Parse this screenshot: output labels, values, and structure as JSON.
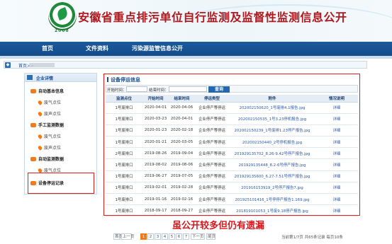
{
  "site": {
    "title": "安徽省重点排污单位自行监测及监督性监测信息公开",
    "logo_year": "2008",
    "accent": "#b0181d"
  },
  "nav": {
    "items": [
      "首页",
      "文件资料",
      "污染源监管信息公开"
    ]
  },
  "breadcrumb": {
    "label": "首页>>"
  },
  "sidebar": {
    "header": "企业详情",
    "sections": [
      {
        "label": "自动基本信息",
        "items": [
          "废气点位",
          "废声点位"
        ]
      },
      {
        "label": "手工监测数据",
        "items": [
          "废气点位",
          "废声点位"
        ]
      },
      {
        "label": "自动监测数据",
        "items": [
          "废气点位"
        ]
      },
      {
        "label": "设备停运记录",
        "items": []
      }
    ]
  },
  "panel": {
    "title": "设备停运信息",
    "filter": {
      "start_label": "开始时间：",
      "end_label": "结束时间：",
      "query_button": "查询"
    },
    "columns": [
      "监测点位",
      "开始时间",
      "结束时间",
      "停运类型",
      "附件",
      "情况说明"
    ],
    "rows": [
      [
        "1号废排口",
        "2020-04-01",
        "2020-04-06",
        "企业停产等停运",
        "202002150620_1号废排4.1报告.jpg",
        "详细"
      ],
      [
        "1号废排口",
        "2020-03-23",
        "2020-04-01",
        "企业停产等停运",
        "202002150535_1号3.23停机报告.jpg",
        "详细"
      ],
      [
        "1号废排口",
        "2020-01-23",
        "2020-02-18",
        "企业停产等停运",
        "202002150239_1号废排1.23停产报告.jpg",
        "详细"
      ],
      [
        "1号废排口",
        "2020-01-21",
        "2020-03-05",
        "企业停产等停运",
        "202002150440_2号停机报告.jpg",
        "详细"
      ],
      [
        "2号废排口",
        "2019-08-26",
        "2019-09-04",
        "企业停产等停运",
        "201929135702_8.26-9.42号停产报告.jpg",
        "详细"
      ],
      [
        "1号废排口",
        "2019-08-02",
        "2019-08-06",
        "企业停产等停运",
        "201929135448_8.2-6号停产报告.jpg",
        "详细"
      ],
      [
        "1号废排口",
        "2019-06-27",
        "2019-07-05",
        "企业停产等停运",
        "201929135600_6.27-7.51号停产报告.jpg",
        "详细"
      ],
      [
        "1号废排口",
        "2019-02-01",
        "2019-02-28",
        "企业停产等停运",
        "201916153919_2号停产报告7.jpg",
        "详细"
      ],
      [
        "1号废排口",
        "2019-01-16",
        "2019-02-16",
        "企业停产等停运",
        "201925101416_1号停停产报告1.169.jpg",
        "详细"
      ],
      [
        "1号废排口",
        "2018-09-17",
        "2018-09-27",
        "企业停产等停运",
        "201819101053_1号废9.18停产报告.jpg",
        "详细"
      ]
    ]
  },
  "annotation": "虽公开较多但仍有遗漏",
  "pager": {
    "buttons": [
      "首页",
      "上一页",
      "1",
      "2",
      "3",
      "4",
      "5",
      "6",
      "7",
      "下一页",
      "尾页"
    ],
    "active": "1",
    "info": "当前第1/7页 共65条记录 每页10条"
  }
}
